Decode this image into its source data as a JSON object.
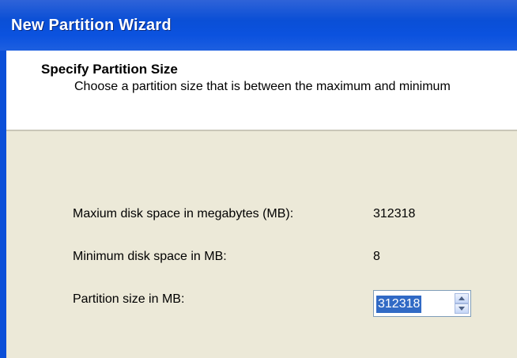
{
  "window": {
    "title": "New Partition Wizard"
  },
  "header": {
    "heading": "Specify Partition Size",
    "subheading": "Choose a partition size that is between the maximum and minimum"
  },
  "fields": {
    "max_label": "Maxium disk space in megabytes (MB):",
    "max_value": "312318",
    "min_label": "Minimum disk space in MB:",
    "min_value": "8",
    "size_label": "Partition size in MB:",
    "size_value": "312318"
  },
  "icons": {
    "spin_up": "chevron-up-icon",
    "spin_down": "chevron-down-icon"
  },
  "colors": {
    "titlebar": "#0b52df",
    "dialog_body": "#ece9d8",
    "selection": "#316ac5"
  }
}
